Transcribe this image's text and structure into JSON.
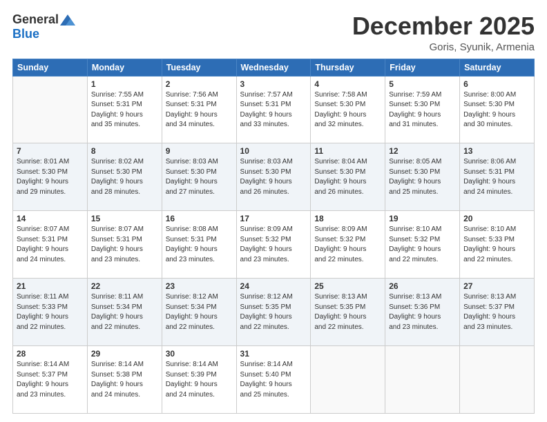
{
  "header": {
    "logo_general": "General",
    "logo_blue": "Blue",
    "month_year": "December 2025",
    "location": "Goris, Syunik, Armenia"
  },
  "weekdays": [
    "Sunday",
    "Monday",
    "Tuesday",
    "Wednesday",
    "Thursday",
    "Friday",
    "Saturday"
  ],
  "weeks": [
    [
      {
        "day": "",
        "info": ""
      },
      {
        "day": "1",
        "info": "Sunrise: 7:55 AM\nSunset: 5:31 PM\nDaylight: 9 hours\nand 35 minutes."
      },
      {
        "day": "2",
        "info": "Sunrise: 7:56 AM\nSunset: 5:31 PM\nDaylight: 9 hours\nand 34 minutes."
      },
      {
        "day": "3",
        "info": "Sunrise: 7:57 AM\nSunset: 5:31 PM\nDaylight: 9 hours\nand 33 minutes."
      },
      {
        "day": "4",
        "info": "Sunrise: 7:58 AM\nSunset: 5:30 PM\nDaylight: 9 hours\nand 32 minutes."
      },
      {
        "day": "5",
        "info": "Sunrise: 7:59 AM\nSunset: 5:30 PM\nDaylight: 9 hours\nand 31 minutes."
      },
      {
        "day": "6",
        "info": "Sunrise: 8:00 AM\nSunset: 5:30 PM\nDaylight: 9 hours\nand 30 minutes."
      }
    ],
    [
      {
        "day": "7",
        "info": "Sunrise: 8:01 AM\nSunset: 5:30 PM\nDaylight: 9 hours\nand 29 minutes."
      },
      {
        "day": "8",
        "info": "Sunrise: 8:02 AM\nSunset: 5:30 PM\nDaylight: 9 hours\nand 28 minutes."
      },
      {
        "day": "9",
        "info": "Sunrise: 8:03 AM\nSunset: 5:30 PM\nDaylight: 9 hours\nand 27 minutes."
      },
      {
        "day": "10",
        "info": "Sunrise: 8:03 AM\nSunset: 5:30 PM\nDaylight: 9 hours\nand 26 minutes."
      },
      {
        "day": "11",
        "info": "Sunrise: 8:04 AM\nSunset: 5:30 PM\nDaylight: 9 hours\nand 26 minutes."
      },
      {
        "day": "12",
        "info": "Sunrise: 8:05 AM\nSunset: 5:30 PM\nDaylight: 9 hours\nand 25 minutes."
      },
      {
        "day": "13",
        "info": "Sunrise: 8:06 AM\nSunset: 5:31 PM\nDaylight: 9 hours\nand 24 minutes."
      }
    ],
    [
      {
        "day": "14",
        "info": "Sunrise: 8:07 AM\nSunset: 5:31 PM\nDaylight: 9 hours\nand 24 minutes."
      },
      {
        "day": "15",
        "info": "Sunrise: 8:07 AM\nSunset: 5:31 PM\nDaylight: 9 hours\nand 23 minutes."
      },
      {
        "day": "16",
        "info": "Sunrise: 8:08 AM\nSunset: 5:31 PM\nDaylight: 9 hours\nand 23 minutes."
      },
      {
        "day": "17",
        "info": "Sunrise: 8:09 AM\nSunset: 5:32 PM\nDaylight: 9 hours\nand 23 minutes."
      },
      {
        "day": "18",
        "info": "Sunrise: 8:09 AM\nSunset: 5:32 PM\nDaylight: 9 hours\nand 22 minutes."
      },
      {
        "day": "19",
        "info": "Sunrise: 8:10 AM\nSunset: 5:32 PM\nDaylight: 9 hours\nand 22 minutes."
      },
      {
        "day": "20",
        "info": "Sunrise: 8:10 AM\nSunset: 5:33 PM\nDaylight: 9 hours\nand 22 minutes."
      }
    ],
    [
      {
        "day": "21",
        "info": "Sunrise: 8:11 AM\nSunset: 5:33 PM\nDaylight: 9 hours\nand 22 minutes."
      },
      {
        "day": "22",
        "info": "Sunrise: 8:11 AM\nSunset: 5:34 PM\nDaylight: 9 hours\nand 22 minutes."
      },
      {
        "day": "23",
        "info": "Sunrise: 8:12 AM\nSunset: 5:34 PM\nDaylight: 9 hours\nand 22 minutes."
      },
      {
        "day": "24",
        "info": "Sunrise: 8:12 AM\nSunset: 5:35 PM\nDaylight: 9 hours\nand 22 minutes."
      },
      {
        "day": "25",
        "info": "Sunrise: 8:13 AM\nSunset: 5:35 PM\nDaylight: 9 hours\nand 22 minutes."
      },
      {
        "day": "26",
        "info": "Sunrise: 8:13 AM\nSunset: 5:36 PM\nDaylight: 9 hours\nand 23 minutes."
      },
      {
        "day": "27",
        "info": "Sunrise: 8:13 AM\nSunset: 5:37 PM\nDaylight: 9 hours\nand 23 minutes."
      }
    ],
    [
      {
        "day": "28",
        "info": "Sunrise: 8:14 AM\nSunset: 5:37 PM\nDaylight: 9 hours\nand 23 minutes."
      },
      {
        "day": "29",
        "info": "Sunrise: 8:14 AM\nSunset: 5:38 PM\nDaylight: 9 hours\nand 24 minutes."
      },
      {
        "day": "30",
        "info": "Sunrise: 8:14 AM\nSunset: 5:39 PM\nDaylight: 9 hours\nand 24 minutes."
      },
      {
        "day": "31",
        "info": "Sunrise: 8:14 AM\nSunset: 5:40 PM\nDaylight: 9 hours\nand 25 minutes."
      },
      {
        "day": "",
        "info": ""
      },
      {
        "day": "",
        "info": ""
      },
      {
        "day": "",
        "info": ""
      }
    ]
  ]
}
